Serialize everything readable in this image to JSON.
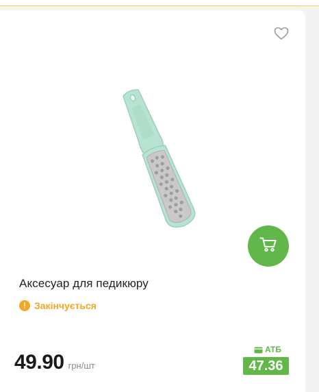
{
  "product": {
    "title": "Аксесуар для педикюру",
    "stock_status": "Закінчується",
    "stock_icon": "warning-icon",
    "price": "49.90",
    "unit": "грн/шт",
    "loyalty_label": "АТБ",
    "loyalty_price": "47.36"
  },
  "icons": {
    "favorite": "heart-outline-icon",
    "cart": "cart-icon",
    "wallet": "wallet-icon"
  },
  "colors": {
    "accent_green": "#61b74a",
    "warning_orange": "#f5a623",
    "top_border_yellow": "#f3d34a"
  }
}
